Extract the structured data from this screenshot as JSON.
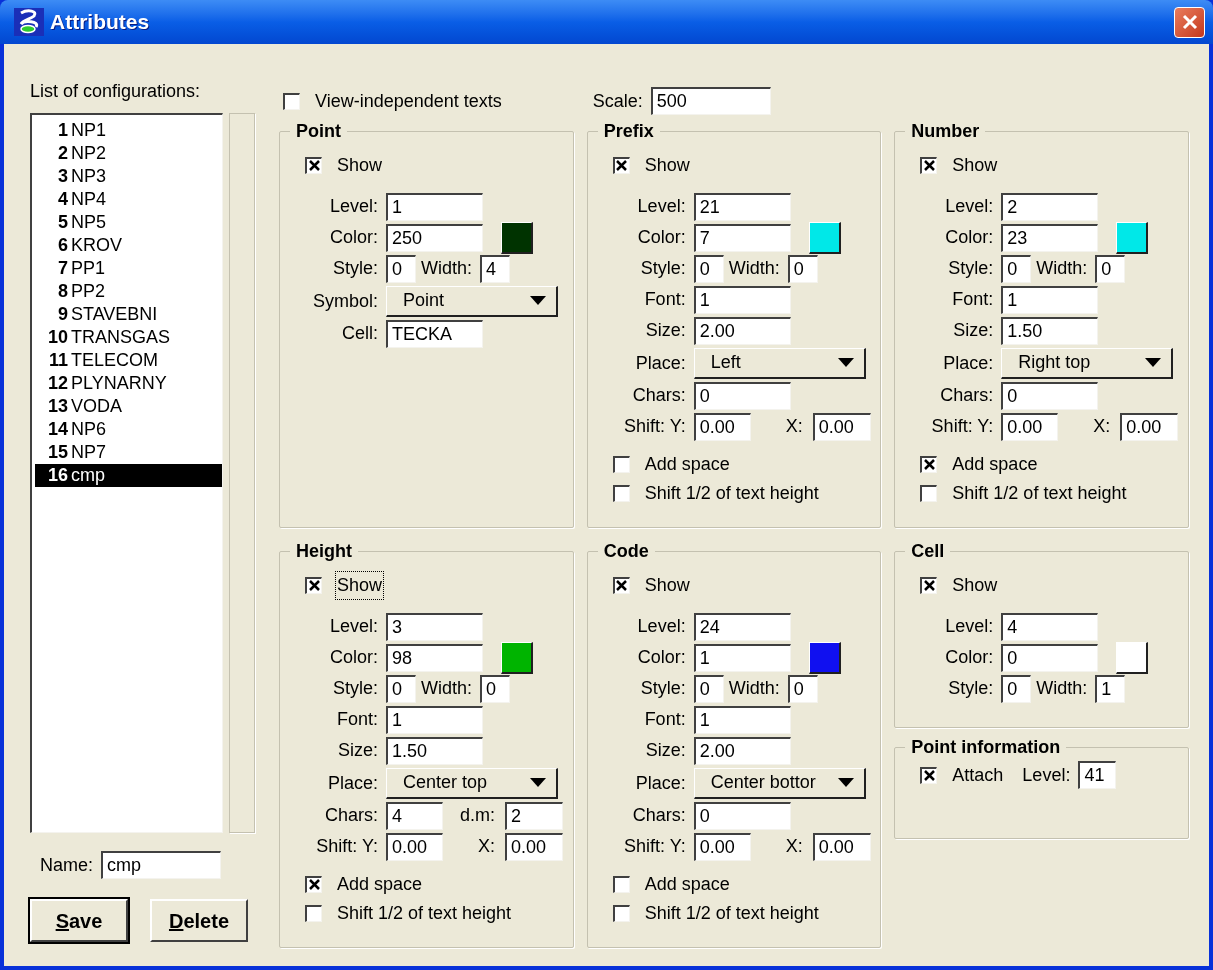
{
  "window": {
    "title": "Attributes"
  },
  "configurations": {
    "label": "List of configurations:",
    "items": [
      {
        "number": "1",
        "name": "NP1",
        "selected": false
      },
      {
        "number": "2",
        "name": "NP2",
        "selected": false
      },
      {
        "number": "3",
        "name": "NP3",
        "selected": false
      },
      {
        "number": "4",
        "name": "NP4",
        "selected": false
      },
      {
        "number": "5",
        "name": "NP5",
        "selected": false
      },
      {
        "number": "6",
        "name": "KROV",
        "selected": false
      },
      {
        "number": "7",
        "name": "PP1",
        "selected": false
      },
      {
        "number": "8",
        "name": "PP2",
        "selected": false
      },
      {
        "number": "9",
        "name": "STAVEBNI",
        "selected": false
      },
      {
        "number": "10",
        "name": "TRANSGAS",
        "selected": false
      },
      {
        "number": "11",
        "name": "TELECOM",
        "selected": false
      },
      {
        "number": "12",
        "name": "PLYNARNY",
        "selected": false
      },
      {
        "number": "13",
        "name": "VODA",
        "selected": false
      },
      {
        "number": "14",
        "name": "NP6",
        "selected": false
      },
      {
        "number": "15",
        "name": "NP7",
        "selected": false
      },
      {
        "number": "16",
        "name": "cmp",
        "selected": true
      }
    ]
  },
  "name_field": {
    "label": "Name:",
    "value": "cmp"
  },
  "buttons": [
    {
      "label": "Save",
      "default": true
    },
    {
      "label": "Delete",
      "default": false
    }
  ],
  "view_independent": {
    "label": "View-independent texts",
    "checked": false
  },
  "scale": {
    "label": "Scale:",
    "value": "500"
  },
  "groups": [
    {
      "title": "Point",
      "show": {
        "label": "Show",
        "checked": true,
        "focused": false
      },
      "rows": [
        {
          "kind": "text",
          "label": "Level:",
          "value": "1"
        },
        {
          "kind": "color",
          "label": "Color:",
          "value": "250",
          "color": "#003300"
        },
        {
          "kind": "style",
          "label": "Style:",
          "value": "0",
          "label2": "Width:",
          "value2": "4"
        },
        {
          "kind": "select",
          "label": "Symbol:",
          "value": "Point"
        },
        {
          "kind": "text",
          "label": "Cell:",
          "value": "TECKA"
        }
      ]
    },
    {
      "title": "Prefix",
      "show": {
        "label": "Show",
        "checked": true,
        "focused": false
      },
      "rows": [
        {
          "kind": "text",
          "label": "Level:",
          "value": "21"
        },
        {
          "kind": "color",
          "label": "Color:",
          "value": "7",
          "color": "#00e8e8"
        },
        {
          "kind": "style",
          "label": "Style:",
          "value": "0",
          "label2": "Width:",
          "value2": "0"
        },
        {
          "kind": "text",
          "label": "Font:",
          "value": "1"
        },
        {
          "kind": "text",
          "label": "Size:",
          "value": "2.00"
        },
        {
          "kind": "select",
          "label": "Place:",
          "value": "Left"
        },
        {
          "kind": "text",
          "label": "Chars:",
          "value": "0"
        },
        {
          "kind": "pair",
          "label": "Shift: Y:",
          "value": "0.00",
          "label2": "X:",
          "value2": "0.00"
        }
      ],
      "options": [
        {
          "label": "Add space",
          "checked": false
        },
        {
          "label": "Shift 1/2 of text height",
          "checked": false
        }
      ]
    },
    {
      "title": "Number",
      "show": {
        "label": "Show",
        "checked": true,
        "focused": false
      },
      "rows": [
        {
          "kind": "text",
          "label": "Level:",
          "value": "2"
        },
        {
          "kind": "color",
          "label": "Color:",
          "value": "23",
          "color": "#00e8e8"
        },
        {
          "kind": "style",
          "label": "Style:",
          "value": "0",
          "label2": "Width:",
          "value2": "0"
        },
        {
          "kind": "text",
          "label": "Font:",
          "value": "1"
        },
        {
          "kind": "text",
          "label": "Size:",
          "value": "1.50"
        },
        {
          "kind": "select",
          "label": "Place:",
          "value": "Right top"
        },
        {
          "kind": "text",
          "label": "Chars:",
          "value": "0"
        },
        {
          "kind": "pair",
          "label": "Shift: Y:",
          "value": "0.00",
          "label2": "X:",
          "value2": "0.00"
        }
      ],
      "options": [
        {
          "label": "Add space",
          "checked": true
        },
        {
          "label": "Shift 1/2 of text height",
          "checked": false
        }
      ]
    },
    {
      "title": "Height",
      "show": {
        "label": "Show",
        "checked": true,
        "focused": true
      },
      "rows": [
        {
          "kind": "text",
          "label": "Level:",
          "value": "3"
        },
        {
          "kind": "color",
          "label": "Color:",
          "value": "98",
          "color": "#00b400"
        },
        {
          "kind": "style",
          "label": "Style:",
          "value": "0",
          "label2": "Width:",
          "value2": "0"
        },
        {
          "kind": "text",
          "label": "Font:",
          "value": "1"
        },
        {
          "kind": "text",
          "label": "Size:",
          "value": "1.50"
        },
        {
          "kind": "select",
          "label": "Place:",
          "value": "Center top"
        },
        {
          "kind": "pair",
          "label": "Chars:",
          "value": "4",
          "label2": "d.m:",
          "value2": "2"
        },
        {
          "kind": "pair",
          "label": "Shift: Y:",
          "value": "0.00",
          "label2": "X:",
          "value2": "0.00"
        }
      ],
      "options": [
        {
          "label": "Add space",
          "checked": true
        },
        {
          "label": "Shift 1/2 of text height",
          "checked": false
        }
      ]
    },
    {
      "title": "Code",
      "show": {
        "label": "Show",
        "checked": true,
        "focused": false
      },
      "rows": [
        {
          "kind": "text",
          "label": "Level:",
          "value": "24"
        },
        {
          "kind": "color",
          "label": "Color:",
          "value": "1",
          "color": "#1010f0"
        },
        {
          "kind": "style",
          "label": "Style:",
          "value": "0",
          "label2": "Width:",
          "value2": "0"
        },
        {
          "kind": "text",
          "label": "Font:",
          "value": "1"
        },
        {
          "kind": "text",
          "label": "Size:",
          "value": "2.00"
        },
        {
          "kind": "select",
          "label": "Place:",
          "value": "Center bottor"
        },
        {
          "kind": "text",
          "label": "Chars:",
          "value": "0"
        },
        {
          "kind": "pair",
          "label": "Shift: Y:",
          "value": "0.00",
          "label2": "X:",
          "value2": "0.00"
        }
      ],
      "options": [
        {
          "label": "Add space",
          "checked": false
        },
        {
          "label": "Shift 1/2 of text height",
          "checked": false
        }
      ]
    },
    {
      "title": "Cell",
      "show": {
        "label": "Show",
        "checked": true,
        "focused": false
      },
      "rows": [
        {
          "kind": "text",
          "label": "Level:",
          "value": "4"
        },
        {
          "kind": "color",
          "label": "Color:",
          "value": "0",
          "color": "#ffffff"
        },
        {
          "kind": "style",
          "label": "Style:",
          "value": "0",
          "label2": "Width:",
          "value2": "1"
        }
      ]
    }
  ],
  "point_information": {
    "title": "Point information",
    "attach": {
      "label": "Attach",
      "checked": true
    },
    "level": {
      "label": "Level:",
      "value": "41"
    }
  }
}
